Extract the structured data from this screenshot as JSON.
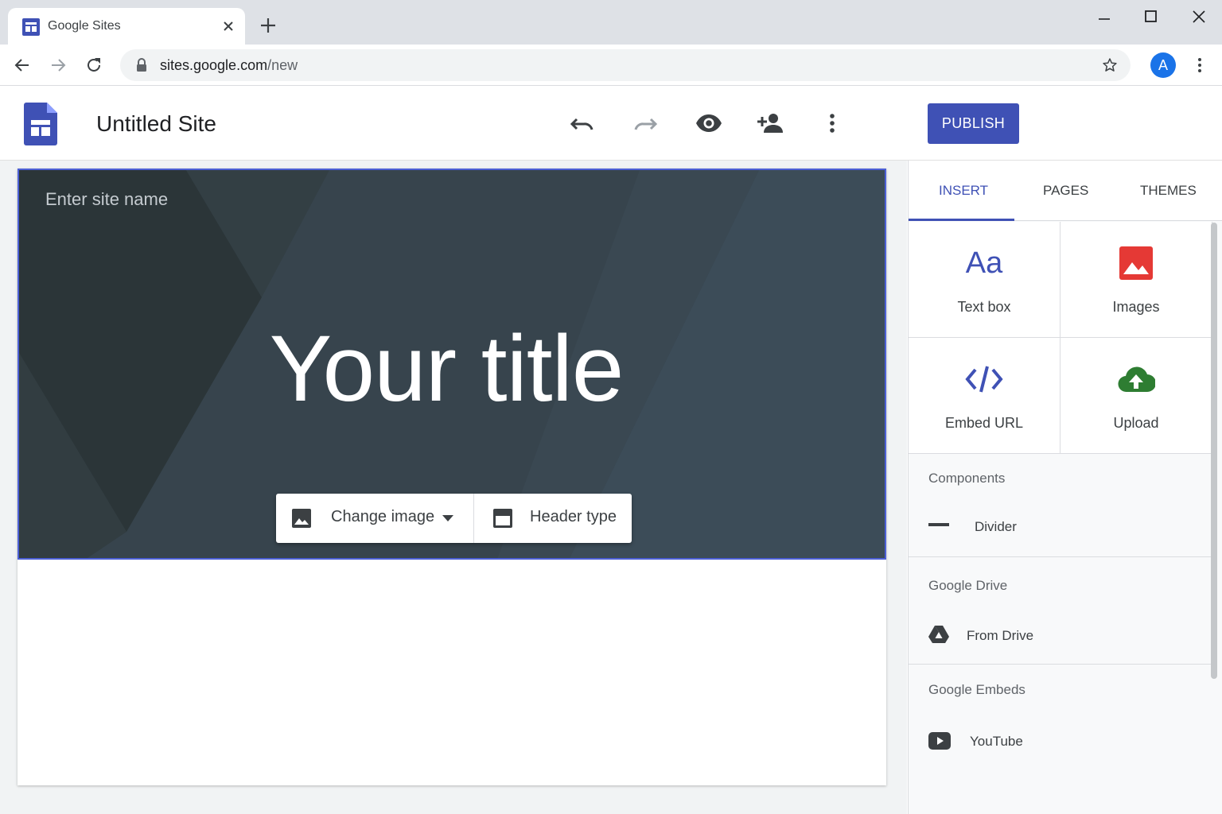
{
  "browser": {
    "tab_title": "Google Sites",
    "url_host": "sites.google.com",
    "url_path": "/new",
    "profile_initial": "A"
  },
  "app": {
    "site_title": "Untitled Site",
    "publish_label": "PUBLISH",
    "accent_color": "#3f51b5"
  },
  "banner": {
    "site_name_placeholder": "Enter site name",
    "title": "Your title",
    "change_image_label": "Change image",
    "header_type_label": "Header type"
  },
  "panel": {
    "tabs": [
      {
        "label": "INSERT",
        "active": true
      },
      {
        "label": "PAGES",
        "active": false
      },
      {
        "label": "THEMES",
        "active": false
      }
    ],
    "tiles": [
      {
        "label": "Text box",
        "icon": "text-box-icon",
        "glyph": "Aa"
      },
      {
        "label": "Images",
        "icon": "image-icon"
      },
      {
        "label": "Embed URL",
        "icon": "code-icon"
      },
      {
        "label": "Upload",
        "icon": "cloud-upload-icon"
      }
    ],
    "sections": [
      {
        "title": "Components",
        "item": "Divider",
        "icon": "divider-icon"
      },
      {
        "title": "Google Drive",
        "item": "From Drive",
        "icon": "drive-icon"
      },
      {
        "title": "Google Embeds",
        "item": "YouTube",
        "icon": "youtube-icon"
      }
    ]
  }
}
